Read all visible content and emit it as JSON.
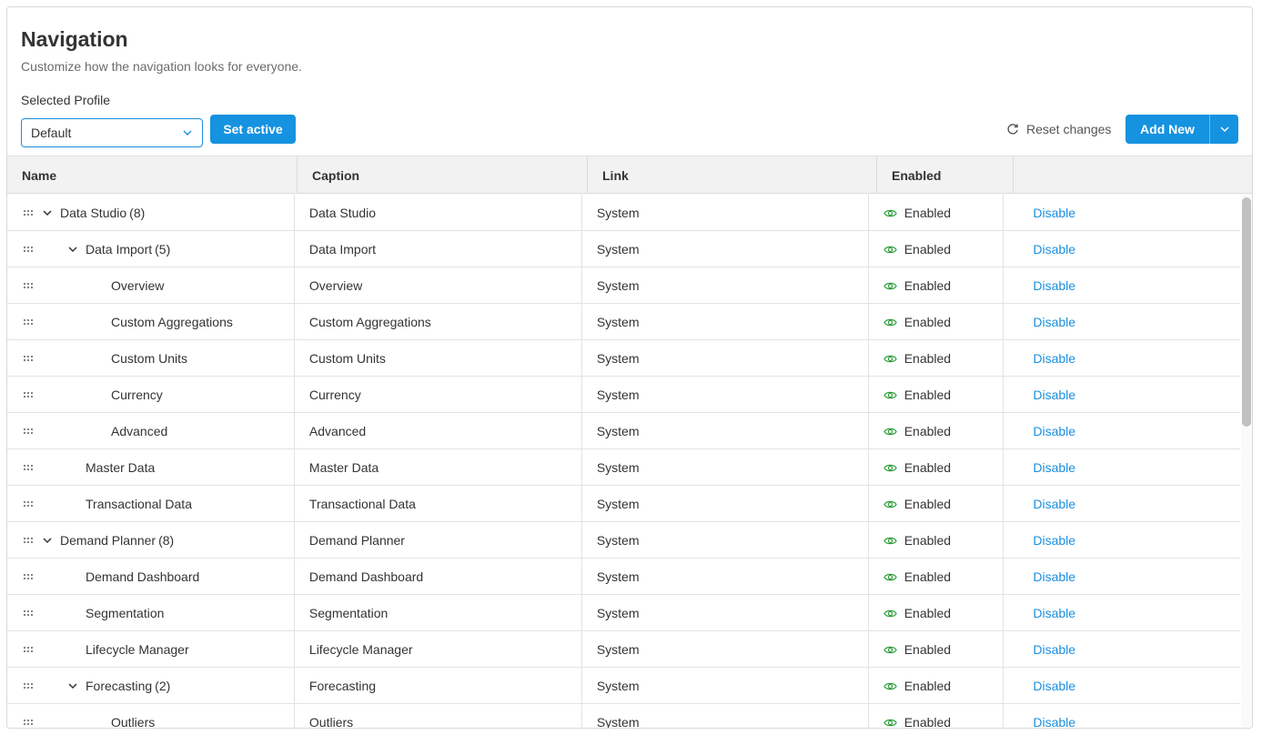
{
  "header": {
    "title": "Navigation",
    "subtitle": "Customize how the navigation looks for everyone."
  },
  "profile": {
    "label": "Selected Profile",
    "selected": "Default",
    "set_active_label": "Set active"
  },
  "toolbar": {
    "reset_label": "Reset changes",
    "add_new_label": "Add New"
  },
  "grid": {
    "columns": [
      "Name",
      "Caption",
      "Link",
      "Enabled",
      ""
    ],
    "rows": [
      {
        "name": "Data Studio",
        "count": "(8)",
        "level": 0,
        "expandable": true,
        "caption": "Data Studio",
        "link": "System",
        "enabled": "Enabled",
        "action": "Disable"
      },
      {
        "name": "Data Import",
        "count": "(5)",
        "level": 1,
        "expandable": true,
        "caption": "Data Import",
        "link": "System",
        "enabled": "Enabled",
        "action": "Disable"
      },
      {
        "name": "Overview",
        "count": "",
        "level": 2,
        "expandable": false,
        "caption": "Overview",
        "link": "System",
        "enabled": "Enabled",
        "action": "Disable"
      },
      {
        "name": "Custom Aggregations",
        "count": "",
        "level": 2,
        "expandable": false,
        "caption": "Custom Aggregations",
        "link": "System",
        "enabled": "Enabled",
        "action": "Disable"
      },
      {
        "name": "Custom Units",
        "count": "",
        "level": 2,
        "expandable": false,
        "caption": "Custom Units",
        "link": "System",
        "enabled": "Enabled",
        "action": "Disable"
      },
      {
        "name": "Currency",
        "count": "",
        "level": 2,
        "expandable": false,
        "caption": "Currency",
        "link": "System",
        "enabled": "Enabled",
        "action": "Disable"
      },
      {
        "name": "Advanced",
        "count": "",
        "level": 2,
        "expandable": false,
        "caption": "Advanced",
        "link": "System",
        "enabled": "Enabled",
        "action": "Disable"
      },
      {
        "name": "Master Data",
        "count": "",
        "level": 1,
        "expandable": false,
        "caption": "Master Data",
        "link": "System",
        "enabled": "Enabled",
        "action": "Disable"
      },
      {
        "name": "Transactional Data",
        "count": "",
        "level": 1,
        "expandable": false,
        "caption": "Transactional Data",
        "link": "System",
        "enabled": "Enabled",
        "action": "Disable"
      },
      {
        "name": "Demand Planner",
        "count": "(8)",
        "level": 0,
        "expandable": true,
        "caption": "Demand Planner",
        "link": "System",
        "enabled": "Enabled",
        "action": "Disable"
      },
      {
        "name": "Demand Dashboard",
        "count": "",
        "level": 1,
        "expandable": false,
        "caption": "Demand Dashboard",
        "link": "System",
        "enabled": "Enabled",
        "action": "Disable"
      },
      {
        "name": "Segmentation",
        "count": "",
        "level": 1,
        "expandable": false,
        "caption": "Segmentation",
        "link": "System",
        "enabled": "Enabled",
        "action": "Disable"
      },
      {
        "name": "Lifecycle Manager",
        "count": "",
        "level": 1,
        "expandable": false,
        "caption": "Lifecycle Manager",
        "link": "System",
        "enabled": "Enabled",
        "action": "Disable"
      },
      {
        "name": "Forecasting",
        "count": "(2)",
        "level": 1,
        "expandable": true,
        "caption": "Forecasting",
        "link": "System",
        "enabled": "Enabled",
        "action": "Disable"
      },
      {
        "name": "Outliers",
        "count": "",
        "level": 2,
        "expandable": false,
        "caption": "Outliers",
        "link": "System",
        "enabled": "Enabled",
        "action": "Disable"
      }
    ]
  },
  "colors": {
    "accent": "#1592e0",
    "link": "#1a8fdf",
    "enabled_icon": "#2e9d3a",
    "header_bg": "#f2f2f2"
  },
  "icons": {
    "drag": "drag-handle-icon",
    "expand": "chevron-down-icon",
    "enabled": "eye-icon",
    "reset": "refresh-icon",
    "dropdown": "chevron-down-icon"
  }
}
